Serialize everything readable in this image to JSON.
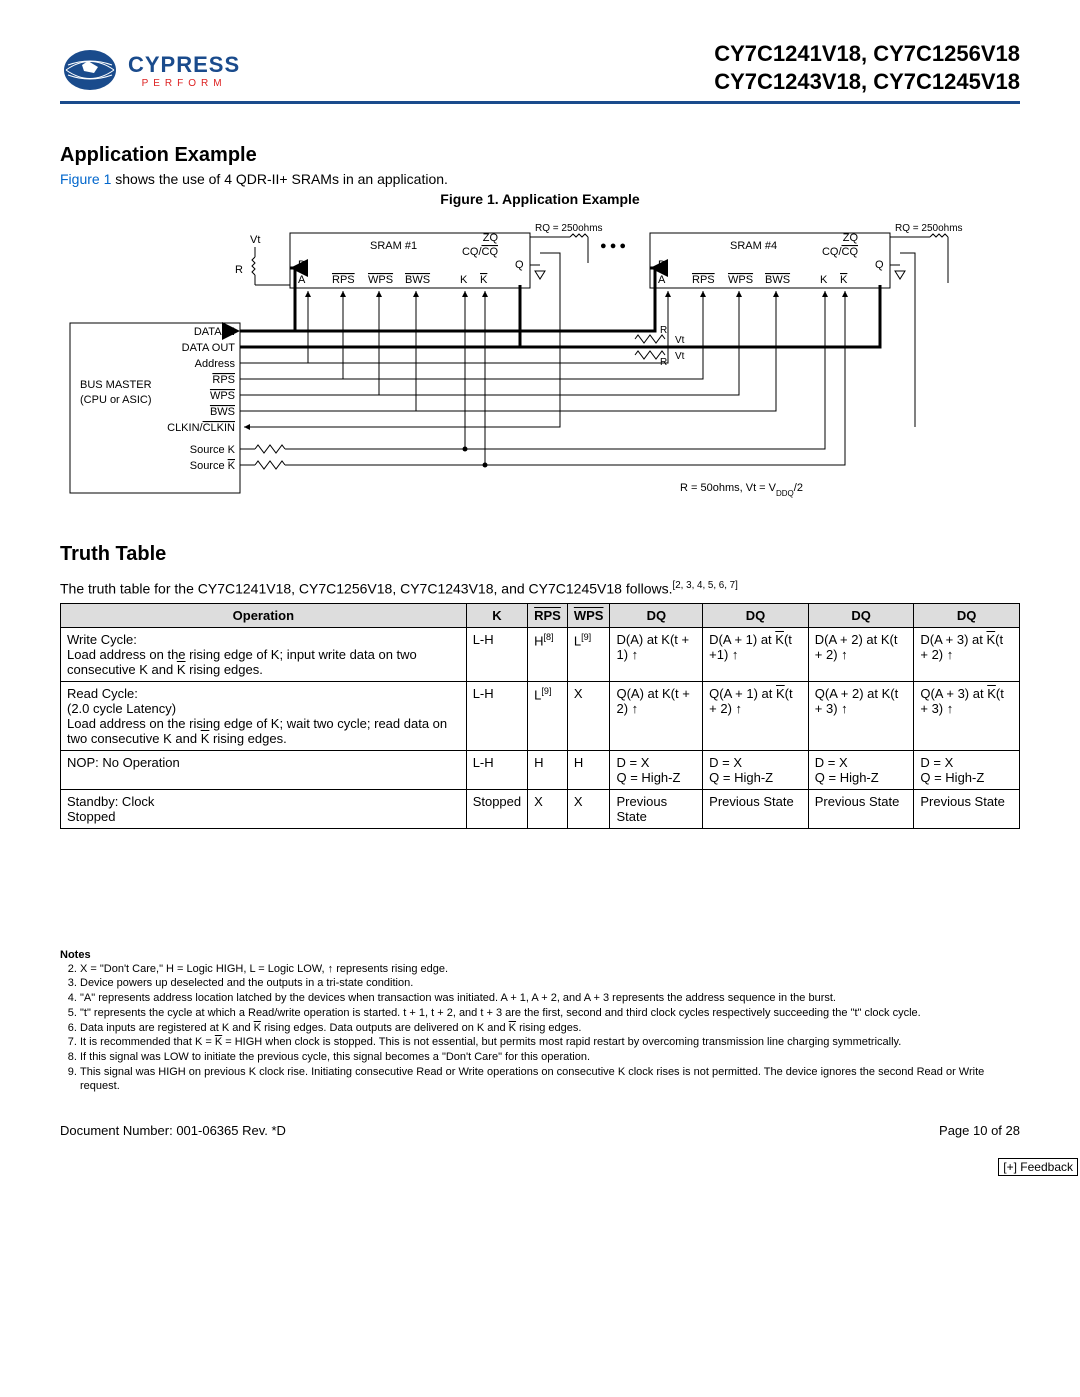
{
  "header": {
    "logo_name": "CYPRESS",
    "logo_sub": "PERFORM",
    "parts_line1": "CY7C1241V18, CY7C1256V18",
    "parts_line2": "CY7C1243V18, CY7C1245V18"
  },
  "app_example": {
    "heading": "Application Example",
    "intro_link": "Figure 1",
    "intro_rest": " shows the use of 4 QDR-II+ SRAMs in an application.",
    "fig_caption": "Figure 1. Application Example"
  },
  "diagram": {
    "vt": "Vt",
    "r": "R",
    "sram1": "SRAM #1",
    "sram4": "SRAM #4",
    "rq": "RQ = 250ohms",
    "zq": "ZQ",
    "cqcq": "CQ/CQ",
    "d": "D",
    "q": "Q",
    "a": "A",
    "rps": "RPS",
    "wps": "WPS",
    "bws": "BWS",
    "k": "K",
    "kbar": "K",
    "dots": "● ● ●",
    "bus_master_title": "BUS  MASTER",
    "bus_master_sub": "(CPU or ASIC)",
    "data_in": "DATA IN",
    "data_out": "DATA OUT",
    "address": "Address",
    "clkin": "CLKIN/CLKIN",
    "sourcek": "Source K",
    "sourcekbar": "Source K",
    "rt_note": "R = 50ohms, Vt = VDDQ/2"
  },
  "truth_section": {
    "heading": "Truth Table",
    "intro": "The truth table for the CY7C1241V18, CY7C1256V18, CY7C1243V18, and CY7C1245V18 follows.",
    "intro_refs": "[2, 3, 4, 5, 6, 7]"
  },
  "truth_table": {
    "headers": [
      "Operation",
      "K",
      "RPS",
      "WPS",
      "DQ",
      "DQ",
      "DQ",
      "DQ"
    ],
    "rows": [
      {
        "op": "Write Cycle:\nLoad address on the rising edge of K; input write data on two consecutive K and K̄ rising edges.",
        "k": "L-H",
        "rps": "H",
        "rps_ref": "[8]",
        "wps": "L",
        "wps_ref": "[9]",
        "dq": [
          "D(A) at K(t + 1) ↑",
          "D(A + 1) at K̄(t +1) ↑",
          "D(A + 2) at K(t + 2) ↑",
          "D(A + 3) at K̄(t + 2) ↑"
        ]
      },
      {
        "op": "Read Cycle:\n(2.0 cycle Latency)\nLoad address on the rising edge of K; wait two cycle; read data on two consecutive K and K̄ rising edges.",
        "k": "L-H",
        "rps": "L",
        "rps_ref": "[9]",
        "wps": "X",
        "wps_ref": "",
        "dq": [
          "Q(A) at K(t + 2) ↑",
          "Q(A + 1) at K̄(t + 2) ↑",
          "Q(A + 2) at K(t + 3) ↑",
          "Q(A + 3) at K̄(t + 3) ↑"
        ]
      },
      {
        "op": "NOP: No Operation",
        "k": "L-H",
        "rps": "H",
        "rps_ref": "",
        "wps": "H",
        "wps_ref": "",
        "dq": [
          "D = X\nQ = High-Z",
          "D = X\nQ = High-Z",
          "D = X\nQ = High-Z",
          "D = X\nQ = High-Z"
        ]
      },
      {
        "op": "Standby: Clock Stopped",
        "k": "Stopped",
        "rps": "X",
        "rps_ref": "",
        "wps": "X",
        "wps_ref": "",
        "dq": [
          "Previous State",
          "Previous State",
          "Previous State",
          "Previous State"
        ]
      }
    ]
  },
  "notes": {
    "title": "Notes",
    "items": [
      "X = \"Don't Care,\" H = Logic HIGH, L = Logic LOW, ↑ represents rising edge.",
      "Device powers up deselected and the outputs in a tri-state condition.",
      "\"A\" represents address location latched by the devices when transaction was initiated. A + 1, A + 2, and A + 3 represents the address sequence in the burst.",
      "\"t\" represents the cycle at which a Read/write operation is started. t + 1, t + 2, and t + 3 are the first, second and third clock cycles respectively succeeding the \"t\" clock cycle.",
      "Data inputs are registered at K and K̄ rising edges. Data outputs are delivered on K and K̄ rising edges.",
      "It is recommended that K = K̄ = HIGH when clock is stopped. This is not essential, but permits most rapid restart by overcoming transmission line charging symmetrically.",
      "If this signal was LOW to initiate the previous cycle, this signal becomes a \"Don't Care\" for this operation.",
      "This signal was HIGH on previous K clock rise. Initiating consecutive Read or Write operations on consecutive K clock rises is not permitted. The device ignores the second Read or Write request."
    ]
  },
  "footer": {
    "docnum": "Document Number: 001-06365 Rev. *D",
    "page": "Page 10 of 28",
    "feedback": "[+] Feedback"
  }
}
